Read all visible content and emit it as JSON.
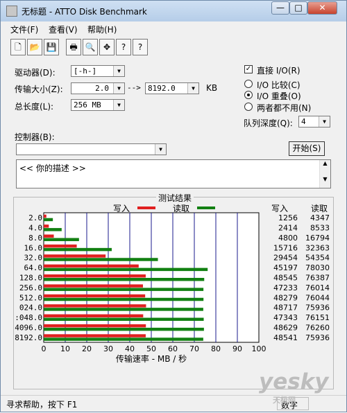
{
  "window": {
    "title": "无标题 - ATTO Disk Benchmark",
    "min": "—",
    "max": "□",
    "close": "✕"
  },
  "menu": [
    "文件(F)",
    "查看(V)",
    "帮助(H)"
  ],
  "toolbar": [
    "🗋",
    "📂",
    "💾",
    "🖶",
    "🔍",
    "✥",
    "?",
    "?"
  ],
  "settings": {
    "drive_label": "驱动器(D):",
    "drive_value": "[-h-]",
    "transfer_label": "传输大小(Z):",
    "transfer_from": "2.0",
    "arrow": "-->",
    "transfer_to": "8192.0",
    "kb": "KB",
    "total_label": "总长度(L):",
    "total_value": "256 MB",
    "direct_io": "直接 I/O(R)",
    "io_compare": "I/O 比较(C)",
    "io_overlap": "I/O 重叠(O)",
    "neither": "两者都不用(N)",
    "queue_label": "队列深度(Q):",
    "queue_value": "4",
    "controller_label": "控制器(B):",
    "start": "开始(S)",
    "desc": "<<    你的描述    >>"
  },
  "results": {
    "group_title": "测试结果",
    "write_legend": "写入",
    "read_legend": "读取",
    "write_col": "写入",
    "read_col": "读取",
    "xlabel": "传输速率 - MB / 秒"
  },
  "chart_data": {
    "type": "bar",
    "categories": [
      "2.0",
      "4.0",
      "8.0",
      "16.0",
      "32.0",
      "64.0",
      "128.0",
      "256.0",
      "512.0",
      "024.0",
      ":048.0",
      "4096.0",
      "8192.0"
    ],
    "series": [
      {
        "name": "写入",
        "color": "#e02020",
        "values": [
          1256,
          2414,
          4800,
          15716,
          29454,
          45197,
          48545,
          47233,
          48279,
          48717,
          47343,
          48629,
          48541
        ]
      },
      {
        "name": "读取",
        "color": "#128012",
        "values": [
          4347,
          8533,
          16794,
          32363,
          54354,
          78030,
          76387,
          76014,
          76044,
          75936,
          76151,
          76260,
          75936
        ]
      }
    ],
    "xticks": [
      "0",
      "10",
      "20",
      "30",
      "40",
      "50",
      "60",
      "70",
      "80",
      "90",
      "100"
    ],
    "xlim": [
      0,
      100
    ],
    "xlabel": "传输速率 - MB / 秒",
    "grid": true
  },
  "status": {
    "text": "寻求帮助，按下 F1",
    "num": "数字"
  },
  "watermark": {
    "main": "yesky",
    "sub": "天极网"
  }
}
